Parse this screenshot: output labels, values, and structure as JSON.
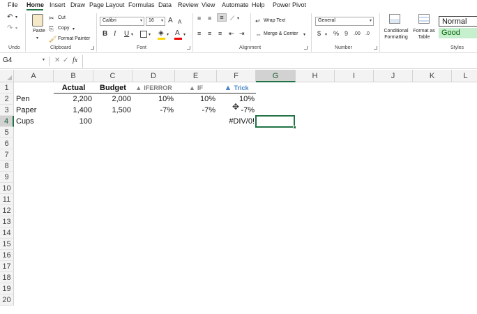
{
  "menu": {
    "items": [
      "File",
      "Home",
      "Insert",
      "Draw",
      "Page Layout",
      "Formulas",
      "Data",
      "Review",
      "View",
      "Automate",
      "Help",
      "Power Pivot"
    ],
    "active": "Home"
  },
  "ribbon": {
    "undo_group": "Undo",
    "clipboard": {
      "paste": "Paste",
      "cut": "Cut",
      "copy": "Copy",
      "format_painter": "Format Painter",
      "group": "Clipboard"
    },
    "font": {
      "name": "Calibri",
      "size": "16",
      "bold": "B",
      "italic": "I",
      "underline": "U",
      "grow": "A",
      "shrink": "A",
      "color_letter": "A",
      "group": "Font"
    },
    "alignment": {
      "wrap_text": "Wrap Text",
      "merge": "Merge & Center",
      "group": "Alignment"
    },
    "number": {
      "format": "General",
      "currency": "$",
      "percent": "%",
      "comma": "9",
      "increase_decimal": ".00",
      "group": "Number"
    },
    "styles": {
      "conditional": "Conditional Formatting",
      "format_table": "Format as Table",
      "normal": "Normal",
      "good": "Good",
      "group": "Styles"
    }
  },
  "formula_bar": {
    "name_box": "G4",
    "cancel": "✕",
    "enter": "✓",
    "fx": "fx",
    "content": ""
  },
  "columns": [
    "A",
    "B",
    "C",
    "D",
    "E",
    "F",
    "G",
    "H",
    "I",
    "J",
    "K",
    "L"
  ],
  "rows": [
    "1",
    "2",
    "3",
    "4",
    "5",
    "6",
    "7",
    "8",
    "9",
    "10",
    "11",
    "12",
    "13",
    "14",
    "15",
    "16",
    "17",
    "18",
    "19",
    "20"
  ],
  "selected_cell": "G4",
  "headers": {
    "actual": "Actual",
    "budget": "Budget",
    "iferror": "IFERROR",
    "if": "IF",
    "trick": "Trick"
  },
  "table_rows": [
    {
      "item": "Pen",
      "actual": "2,200",
      "budget": "2,000",
      "iferror": "10%",
      "if": "10%",
      "trick": "10%"
    },
    {
      "item": "Paper",
      "actual": "1,400",
      "budget": "1,500",
      "iferror": "-7%",
      "if": "-7%",
      "trick": "-7%"
    },
    {
      "item": "Cups",
      "actual": "100",
      "budget": "",
      "iferror": "",
      "if": "",
      "trick": "#DIV/0!"
    }
  ],
  "colors": {
    "excel_green": "#217346",
    "good_fill": "#c6efce",
    "good_text": "#006100",
    "trick_blue": "#4a86c8",
    "header_grey": "#7f7f7f"
  }
}
